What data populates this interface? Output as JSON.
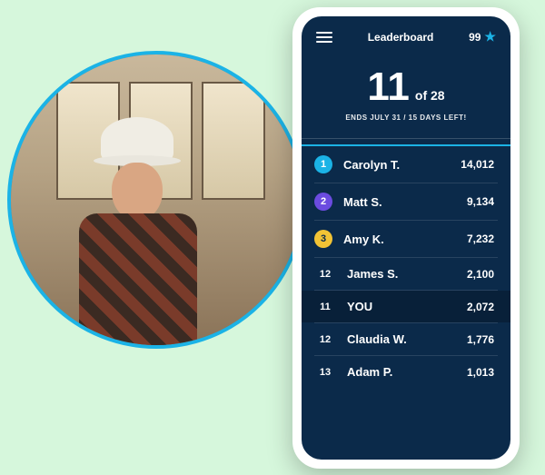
{
  "photo": {
    "alt": "Smiling woman in white hard hat and plaid shirt writing at a drafting table"
  },
  "app": {
    "header": {
      "title": "Leaderboard",
      "points": "99"
    },
    "rank": {
      "current": "11",
      "of_label": "of 28",
      "sub": "ENDS JULY 31 / 15 DAYS LEFT!"
    },
    "rows": [
      {
        "pos": "1",
        "name": "Carolyn T.",
        "score": "14,012",
        "badge": "b1"
      },
      {
        "pos": "2",
        "name": "Matt S.",
        "score": "9,134",
        "badge": "b2"
      },
      {
        "pos": "3",
        "name": "Amy K.",
        "score": "7,232",
        "badge": "b3"
      },
      {
        "pos": "12",
        "name": "James S.",
        "score": "2,100",
        "badge": null
      },
      {
        "pos": "11",
        "name": "YOU",
        "score": "2,072",
        "badge": null,
        "you": true
      },
      {
        "pos": "12",
        "name": "Claudia W.",
        "score": "1,776",
        "badge": null
      },
      {
        "pos": "13",
        "name": "Adam P.",
        "score": "1,013",
        "badge": null
      }
    ]
  }
}
